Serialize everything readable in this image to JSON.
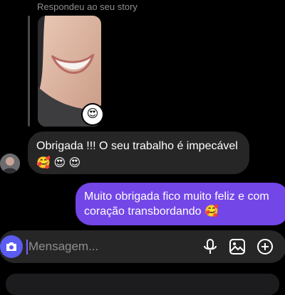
{
  "story": {
    "replied_label": "Respondeu ao seu story",
    "reaction_emoji": "😍",
    "thumbnail_icon": "story-thumbnail"
  },
  "messages": [
    {
      "direction": "incoming",
      "text": "Obrigada !!! O seu trabalho é impecável",
      "emojis": "🥰 😍 😍"
    },
    {
      "direction": "outgoing",
      "text": "Muito obrigada fico muito feliz e com coração transbordando 🥰"
    }
  ],
  "composer": {
    "placeholder": "Mensagem...",
    "icons": [
      "camera-icon",
      "microphone-icon",
      "gallery-icon",
      "plus-icon"
    ]
  },
  "colors": {
    "background": "#000000",
    "incoming_bubble": "#262626",
    "outgoing_bubble": "#7346e8",
    "camera_button": "#5b5cf0",
    "caret": "#7b61ff"
  }
}
